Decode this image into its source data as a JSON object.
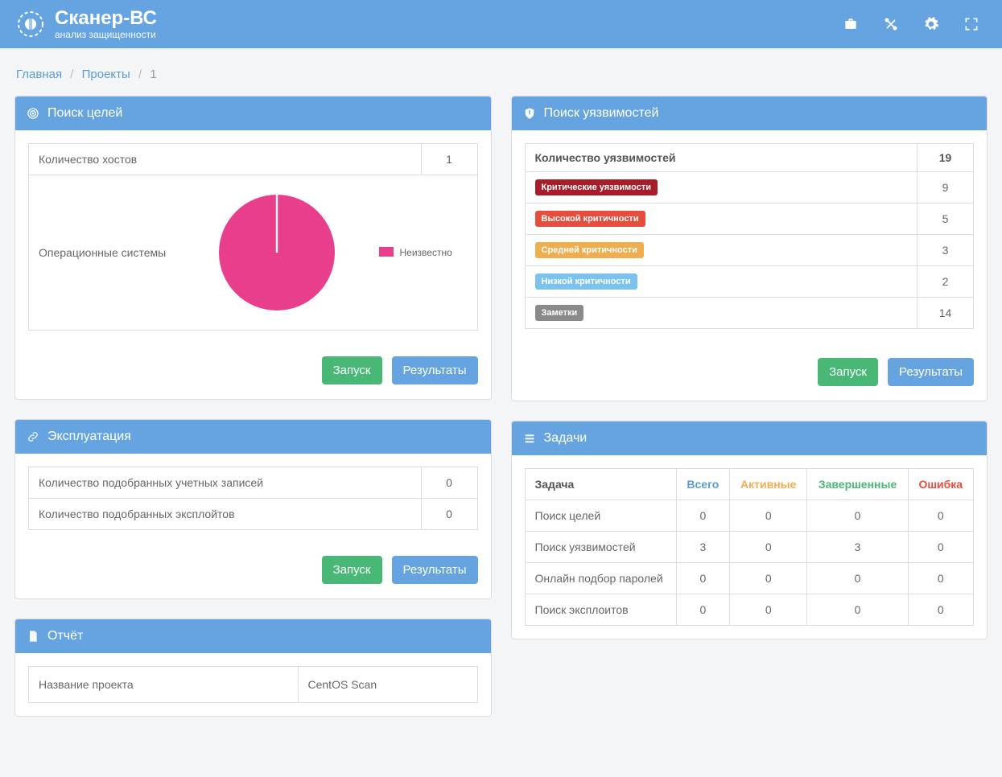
{
  "brand": {
    "title": "Сканер-ВС",
    "subtitle": "анализ защищенности"
  },
  "breadcrumb": {
    "home": "Главная",
    "projects": "Проекты",
    "current": "1"
  },
  "targets_panel": {
    "title": "Поиск целей",
    "hosts_label": "Количество хостов",
    "hosts_count": "1",
    "os_label": "Операционные системы",
    "legend_unknown": "Неизвестно",
    "btn_run": "Запуск",
    "btn_results": "Результаты"
  },
  "vuln_panel": {
    "title": "Поиск уязвимостей",
    "total_label": "Количество уязвимостей",
    "total_count": "19",
    "rows": [
      {
        "label": "Критические уязвимости",
        "class": "tag-critical",
        "count": "9"
      },
      {
        "label": "Высокой критичности",
        "class": "tag-high",
        "count": "5"
      },
      {
        "label": "Средней критичности",
        "class": "tag-medium",
        "count": "3"
      },
      {
        "label": "Низкой критичности",
        "class": "tag-low",
        "count": "2"
      },
      {
        "label": "Заметки",
        "class": "tag-note",
        "count": "14"
      }
    ],
    "btn_run": "Запуск",
    "btn_results": "Результаты"
  },
  "exploit_panel": {
    "title": "Эксплуатация",
    "rows": [
      {
        "label": "Количество подобранных учетных записей",
        "count": "0"
      },
      {
        "label": "Количество подобранных эксплойтов",
        "count": "0"
      }
    ],
    "btn_run": "Запуск",
    "btn_results": "Результаты"
  },
  "tasks_panel": {
    "title": "Задачи",
    "headers": {
      "task": "Задача",
      "all": "Всего",
      "active": "Активные",
      "done": "Завершенные",
      "error": "Ошибка"
    },
    "rows": [
      {
        "name": "Поиск целей",
        "all": "0",
        "active": "0",
        "done": "0",
        "error": "0"
      },
      {
        "name": "Поиск уязвимостей",
        "all": "3",
        "active": "0",
        "done": "3",
        "error": "0"
      },
      {
        "name": "Онлайн подбор паролей",
        "all": "0",
        "active": "0",
        "done": "0",
        "error": "0"
      },
      {
        "name": "Поиск эксплоитов",
        "all": "0",
        "active": "0",
        "done": "0",
        "error": "0"
      }
    ]
  },
  "report_panel": {
    "title": "Отчёт",
    "label": "Название проекта",
    "value": "CentOS Scan"
  },
  "chart_data": {
    "type": "pie",
    "title": "Операционные системы",
    "series": [
      {
        "name": "Неизвестно",
        "value": 1,
        "color": "#e83e8c"
      }
    ]
  }
}
